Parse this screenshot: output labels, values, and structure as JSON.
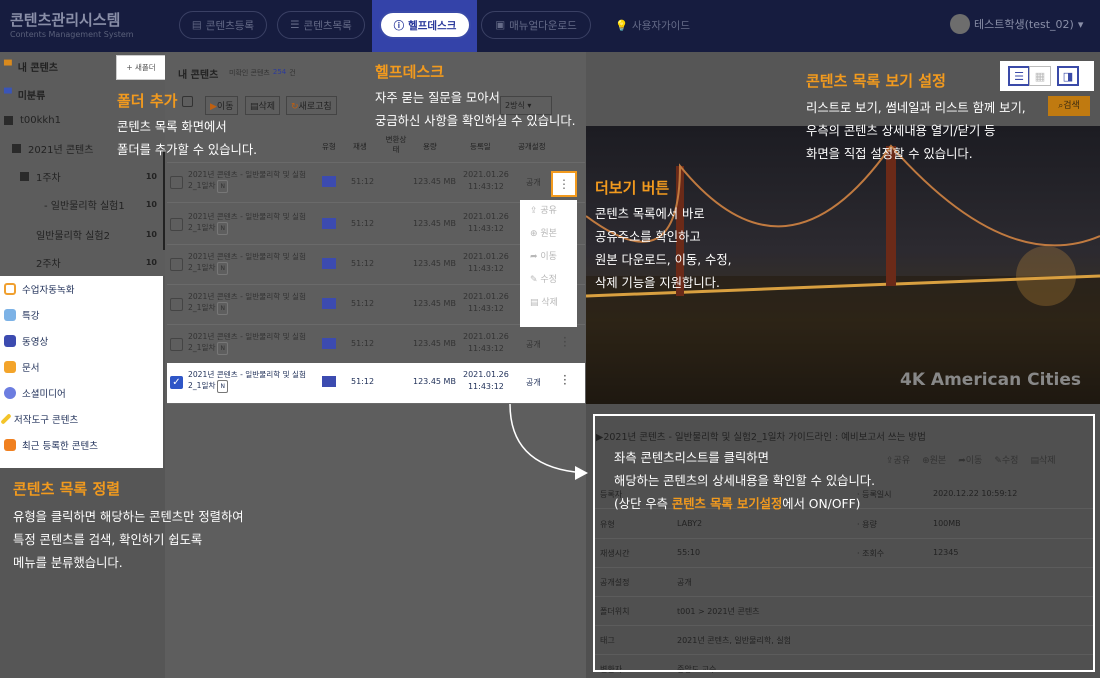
{
  "app": {
    "title": "콘텐츠관리시스템",
    "subtitle": "Contents Management System"
  },
  "nav": [
    {
      "label": "콘텐츠등록",
      "icon": "document-icon",
      "active": false
    },
    {
      "label": "콘텐츠목록",
      "icon": "list-icon",
      "active": false
    },
    {
      "label": "헬프데스크",
      "icon": "info-icon",
      "active": true
    },
    {
      "label": "매뉴얼다운로드",
      "icon": "download-icon",
      "active": false
    },
    {
      "label": "사용자가이드",
      "icon": "bulb-icon",
      "active": false
    }
  ],
  "user": {
    "name": "테스트학생(test_02)"
  },
  "tree": {
    "my_content": "내 콘텐츠",
    "unclassified": "미분류",
    "root": "t00kkh1",
    "y2021": "2021년 콘텐츠",
    "week1": "1주차",
    "week1_count": "10",
    "exp1": "- 일반물리학 실험1",
    "exp1_count": "10",
    "exp2": "일반물리학 실험2",
    "exp2_count": "10",
    "week2": "2주차",
    "week2_count": "10"
  },
  "new_folder_label": "+ 새폴더",
  "categories": [
    {
      "label": "수업자동녹화",
      "icon": "record-icon"
    },
    {
      "label": "특강",
      "icon": "book-icon"
    },
    {
      "label": "동영상",
      "icon": "video-icon"
    },
    {
      "label": "문서",
      "icon": "folder-icon"
    },
    {
      "label": "소셜미디어",
      "icon": "chat-icon"
    },
    {
      "label": "저작도구 콘텐츠",
      "icon": "pencil-icon"
    },
    {
      "label": "최근 등록한 콘텐츠",
      "icon": "new-icon"
    }
  ],
  "list": {
    "header_title": "내 콘텐츠",
    "header_sub": "미확인 콘텐츠",
    "header_badge": "254",
    "header_suffix": "건",
    "btn_move": "이동",
    "btn_delete": "삭제",
    "btn_refresh": "새로고침",
    "sort_label": "2방식",
    "columns": [
      "유형",
      "재생",
      "변환상태",
      "용량",
      "등록일",
      "공개설정"
    ],
    "rows": [
      {
        "title": "2021년 콘텐츠 - 일반물리학 및 실험2_1일차",
        "tag": "N",
        "duration": "51:12",
        "size": "123.45 MB",
        "date": "2021.01.26",
        "time": "11:43:12",
        "public": "공개",
        "selected": false
      },
      {
        "title": "2021년 콘텐츠 - 일반물리학 및 실험2_1일차",
        "tag": "N",
        "duration": "51:12",
        "size": "123.45 MB",
        "date": "2021.01.26",
        "time": "11:43:12",
        "public": "공개",
        "selected": false
      },
      {
        "title": "2021년 콘텐츠 - 일반물리학 및 실험2_1일차",
        "tag": "N",
        "duration": "51:12",
        "size": "123.45 MB",
        "date": "2021.01.26",
        "time": "11:43:12",
        "public": "공개",
        "selected": false
      },
      {
        "title": "2021년 콘텐츠 - 일반물리학 및 실험2_1일차",
        "tag": "N",
        "duration": "51:12",
        "size": "123.45 MB",
        "date": "2021.01.26",
        "time": "11:43:12",
        "public": "공개",
        "selected": false
      },
      {
        "title": "2021년 콘텐츠 - 일반물리학 및 실험2_1일차",
        "tag": "N",
        "duration": "51:12",
        "size": "123.45 MB",
        "date": "2021.01.26",
        "time": "11:43:12",
        "public": "공개",
        "selected": false
      },
      {
        "title": "2021년 콘텐츠 - 일반물리학 및 실험2_1일차",
        "tag": "N",
        "duration": "51:12",
        "size": "123.45 MB",
        "date": "2021.01.26",
        "time": "11:43:12",
        "public": "공개",
        "selected": true
      }
    ]
  },
  "context_menu": [
    "공유",
    "원본",
    "이동",
    "수정",
    "삭제"
  ],
  "search_btn": "검색",
  "video": {
    "watermark": "4K American Cities"
  },
  "detail": {
    "title": "2021년 콘텐츠 - 일반물리학 및 실험2_1일차 가이드라인 : 예비보고서 쓰는 방법",
    "actions": [
      "공유",
      "원본",
      "이동",
      "수정",
      "삭제"
    ],
    "rows": [
      {
        "k": "등록자",
        "v": "",
        "k2": "· 등록일시",
        "v2": "2020.12.22 10:59:12"
      },
      {
        "k": "유형",
        "v": "LABY2",
        "k2": "· 용량",
        "v2": "100MB"
      },
      {
        "k": "재생시간",
        "v": "55:10",
        "k2": "· 조회수",
        "v2": "12345"
      },
      {
        "k": "공개설정",
        "v": "공개",
        "k2": "",
        "v2": ""
      },
      {
        "k": "폴더위치",
        "v": "t001 > 2021년 콘텐츠",
        "k2": "",
        "v2": ""
      },
      {
        "k": "태그",
        "v": "2021년 콘텐츠, 일반물리학, 실험",
        "k2": "",
        "v2": ""
      },
      {
        "k": "변환자",
        "v": "중앙도 교수",
        "k2": "",
        "v2": ""
      }
    ]
  },
  "annotations": {
    "folder": {
      "title": "폴더 추가",
      "l1": "콘텐츠 목록 화면에서",
      "l2": "폴더를 추가할 수 있습니다."
    },
    "help": {
      "title": "헬프데스크",
      "l1": "자주 묻는 질문을 모아서",
      "l2": "궁금하신 사항을 확인하실 수 있습니다."
    },
    "viewset": {
      "title": "콘텐츠 목록 보기 설정",
      "l1": "리스트로 보기, 썸네일과 리스트 함께 보기,",
      "l2": "우측의 콘텐츠 상세내용 열기/닫기 등",
      "l3": "화면을 직접 설정할 수 있습니다."
    },
    "more": {
      "title": "더보기 버튼",
      "l1": "콘텐츠 목록에서 바로",
      "l2": "공유주소를 확인하고",
      "l3": "원본 다운로드, 이동, 수정,",
      "l4": "삭제 기능을 지원합니다."
    },
    "sort": {
      "title": "콘텐츠 목록 정렬",
      "l1": "유형을 클릭하면 해당하는 콘텐츠만 정렬하여",
      "l2": "특정 콘텐츠를 검색, 확인하기 쉽도록",
      "l3": "메뉴를 분류했습니다."
    },
    "detail": {
      "l1": "좌측 콘텐츠리스트를 클릭하면",
      "l2": "해당하는 콘텐츠의 상세내용을 확인할 수 있습니다.",
      "l3_pre": "(상단 우측 ",
      "l3_hl": "콘텐츠 목록 보기설정",
      "l3_post": "에서 ON/OFF)"
    }
  },
  "colors": {
    "accent": "#f29a1e",
    "nav_bg": "#161c3f",
    "nav_active": "#3443a9",
    "overlay": "#565656"
  }
}
